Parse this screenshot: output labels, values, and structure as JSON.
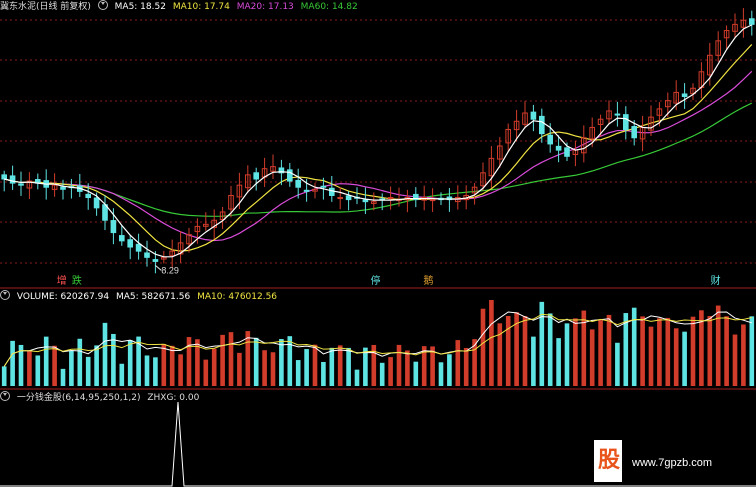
{
  "colors": {
    "up": "#d23c2b",
    "down": "#5fe4e4",
    "ma5": "#ffffff",
    "ma10": "#f0e442",
    "ma20": "#d94cd9",
    "ma60": "#37c837",
    "grid": "#8a1c1c"
  },
  "header": {
    "title": "冀东水泥(日线 前复权)",
    "ma5": "MA5: 18.52",
    "ma10": "MA10: 17.74",
    "ma20": "MA20: 17.13",
    "ma60": "MA60: 14.82"
  },
  "volume_header": {
    "label": "VOLUME: 620267.94",
    "ma5": "MA5: 582671.56",
    "ma10": "MA10: 476012.56"
  },
  "indicator_header": {
    "label": "一分钱金股(6,14,95,250,1,2)",
    "zhxg": "ZHXG: 0.00"
  },
  "annotations": {
    "low_price": "8.29",
    "tags": [
      {
        "text": "增",
        "color": "#ff5050"
      },
      {
        "text": "跌",
        "color": "#37c837"
      },
      {
        "text": "停",
        "color": "#5fe4e4"
      },
      {
        "text": "鹅",
        "color": "#e0a030"
      },
      {
        "text": "财",
        "color": "#5fe4e4"
      }
    ]
  },
  "watermark": {
    "char": "股",
    "url": "www.7gpzb.com"
  },
  "chart_data": {
    "type": "candlestick",
    "title": "冀东水泥(日线 前复权)",
    "price_range_visible": [
      7.5,
      20.5
    ],
    "annotated_low": 8.29,
    "close_approx": [
      12.4,
      12.2,
      12.1,
      12.3,
      12.2,
      12.0,
      12.1,
      11.9,
      12.0,
      11.8,
      11.5,
      11.0,
      10.4,
      9.8,
      9.4,
      9.1,
      8.9,
      8.6,
      8.4,
      8.6,
      8.9,
      9.3,
      9.7,
      10.1,
      10.2,
      10.4,
      10.8,
      11.6,
      12.1,
      12.6,
      12.4,
      12.9,
      13.0,
      12.7,
      12.3,
      12.0,
      11.8,
      11.9,
      12.0,
      11.6,
      11.5,
      11.4,
      11.5,
      11.3,
      11.3,
      11.4,
      11.5,
      11.4,
      11.5,
      11.4,
      11.5,
      11.4,
      11.4,
      11.4,
      11.5,
      11.6,
      12.0,
      12.7,
      13.4,
      14.0,
      14.8,
      15.2,
      15.6,
      15.3,
      14.6,
      14.1,
      13.8,
      13.5,
      13.8,
      14.4,
      14.9,
      15.3,
      15.7,
      15.5,
      14.8,
      14.4,
      14.9,
      15.4,
      15.8,
      16.2,
      16.6,
      16.4,
      16.8,
      17.6,
      18.4,
      19.1,
      19.6,
      19.9,
      20.1,
      19.9
    ],
    "ma_labels": {
      "MA5": 18.52,
      "MA10": 17.74,
      "MA20": 17.13,
      "MA60": 14.82
    },
    "volume": {
      "last": 620267.94,
      "ma5": 582671.56,
      "ma10": 476012.56
    },
    "indicator": {
      "name": "一分钱金股",
      "params": [
        6,
        14,
        95,
        250,
        1,
        2
      ],
      "ZHXG": 0.0
    }
  }
}
